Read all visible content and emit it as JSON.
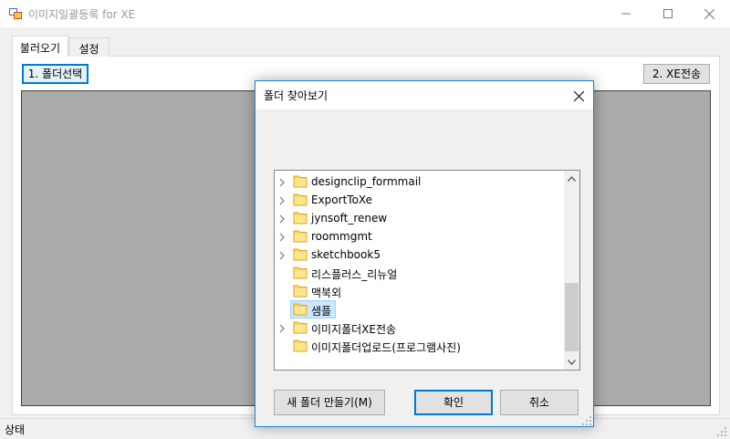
{
  "window": {
    "title": "이미지일괄등록 for XE"
  },
  "tabs": [
    {
      "label": "불러오기",
      "active": true
    },
    {
      "label": "설정",
      "active": false
    }
  ],
  "toolbar": {
    "select_folder_label": "1. 폴더선택",
    "xe_send_label": "2. XE전송"
  },
  "status": {
    "label": "상태"
  },
  "dialog": {
    "title": "폴더 찾아보기",
    "tree_items": [
      {
        "label": "designclip_formmail",
        "expandable": true,
        "selected": false
      },
      {
        "label": "ExportToXe",
        "expandable": true,
        "selected": false
      },
      {
        "label": "jynsoft_renew",
        "expandable": true,
        "selected": false
      },
      {
        "label": "roommgmt",
        "expandable": true,
        "selected": false
      },
      {
        "label": "sketchbook5",
        "expandable": true,
        "selected": false
      },
      {
        "label": "리스플러스_리뉴얼",
        "expandable": false,
        "selected": false
      },
      {
        "label": "맥북외",
        "expandable": false,
        "selected": false
      },
      {
        "label": "샘플",
        "expandable": false,
        "selected": true
      },
      {
        "label": "이미지폴더XE전송",
        "expandable": true,
        "selected": false
      },
      {
        "label": "이미지폴더업로드(프로그램사진)",
        "expandable": false,
        "selected": false
      }
    ],
    "new_folder_label": "새 폴더 만들기(M)",
    "ok_label": "확인",
    "cancel_label": "취소"
  },
  "colors": {
    "accent": "#0078d7",
    "folder_fill": "#ffd75e",
    "selection": "#cce8ff",
    "image_area": "#ababab"
  }
}
